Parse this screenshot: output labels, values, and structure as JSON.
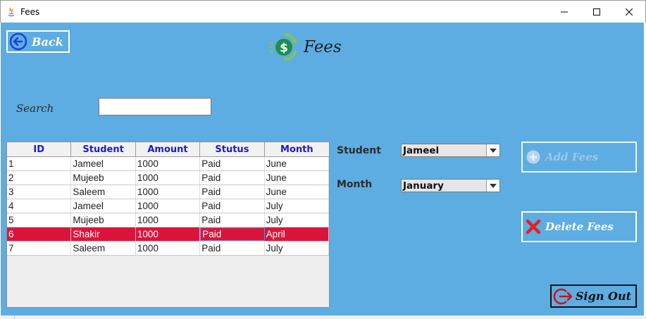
{
  "window": {
    "title": "Fees"
  },
  "nav": {
    "back_label": "Back"
  },
  "header": {
    "title": "Fees"
  },
  "search": {
    "label": "Search",
    "value": ""
  },
  "table": {
    "columns": [
      "ID",
      "Student",
      "Amount",
      "Stutus",
      "Month"
    ],
    "rows": [
      [
        "1",
        "Jameel",
        "1000",
        "Paid",
        "June"
      ],
      [
        "2",
        "Mujeeb",
        "1000",
        "Paid",
        "June"
      ],
      [
        "3",
        "Saleem",
        "1000",
        "Paid",
        "June"
      ],
      [
        "4",
        "Jameel",
        "1000",
        "Paid",
        "July"
      ],
      [
        "5",
        "Mujeeb",
        "1000",
        "Paid",
        "July"
      ],
      [
        "6",
        "Shakir",
        "1000",
        "Paid",
        "April"
      ],
      [
        "7",
        "Saleem",
        "1000",
        "Paid",
        "July"
      ]
    ],
    "selected_row_index": 5
  },
  "form": {
    "student_label": "Student",
    "student_value": "Jameel",
    "month_label": "Month",
    "month_value": "January"
  },
  "buttons": {
    "add_fees": "Add Fees",
    "delete_fees": "Delete Fees",
    "sign_out": "Sign Out"
  },
  "colors": {
    "background": "#5dade2",
    "selected_row": "#dc143c",
    "header_text": "#1a1ad0",
    "dollar_icon": "#1e8f4e",
    "refresh_ring": "#8bc34a",
    "delete_x": "#e52020",
    "signout_icon": "#d01010"
  },
  "icons": {
    "back": "back-arrow-circle-icon",
    "header": "dollar-refresh-icon",
    "add": "plus-circle-icon",
    "delete": "x-icon",
    "sign_out": "exit-icon",
    "combo_arrow": "caret-down-icon"
  }
}
